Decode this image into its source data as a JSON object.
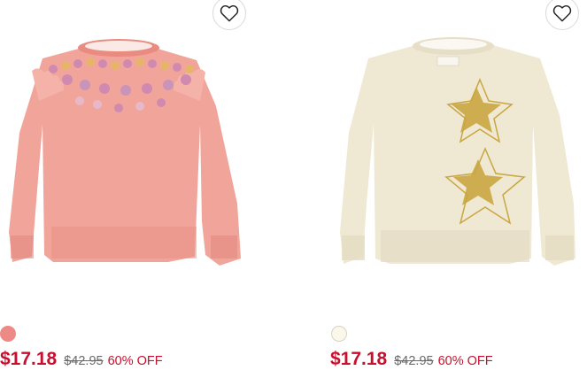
{
  "products": [
    {
      "image_alt": "Pink sweater with sequin embellished yoke and ruffle shoulders",
      "color_swatch": "#ee8a86",
      "sale_price": "$17.18",
      "original_price": "$42.95",
      "discount": "60% OFF"
    },
    {
      "image_alt": "Cream sweater with gold sequin stars",
      "color_swatch": "#fbf7ea",
      "sale_price": "$17.18",
      "original_price": "$42.95",
      "discount": "60% OFF"
    }
  ],
  "colors": {
    "sale": "#c8102e",
    "strikethrough": "#6b6b6b"
  }
}
